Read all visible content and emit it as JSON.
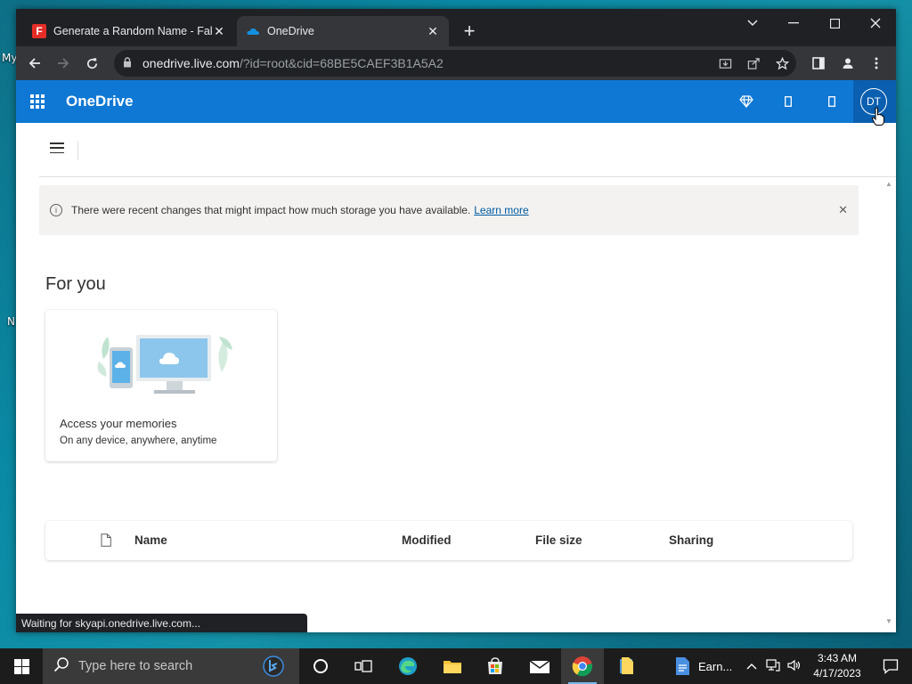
{
  "desktop": {
    "label_my": "My",
    "label_n": "N"
  },
  "browser": {
    "tabs": [
      {
        "title": "Generate a Random Name - Fake",
        "active": false
      },
      {
        "title": "OneDrive",
        "active": true
      }
    ],
    "new_tab": "+",
    "window_controls": {
      "minimize": "﹀",
      "min": "–",
      "max": "☐",
      "close": "✕"
    },
    "url": {
      "host": "onedrive.live.com",
      "rest": "/?id=root&cid=68BE5CAEF3B1A5A2"
    },
    "status_text": "Waiting for skyapi.onedrive.live.com..."
  },
  "onedrive": {
    "brand": "OneDrive",
    "avatar_initials": "DT",
    "banner": {
      "message": "There were recent changes that might impact how much storage you have available.",
      "link": "Learn more"
    },
    "section_title": "For you",
    "card": {
      "title": "Access your memories",
      "subtitle": "On any device, anywhere, anytime"
    },
    "columns": [
      "Name",
      "Modified",
      "File size",
      "Sharing"
    ]
  },
  "taskbar": {
    "search_placeholder": "Type here to search",
    "pinned_label": "Earn...",
    "time": "3:43 AM",
    "date": "4/17/2023"
  },
  "colors": {
    "onedrive_blue": "#0f78d4",
    "link": "#005a9e",
    "chrome_dark": "#202124"
  }
}
